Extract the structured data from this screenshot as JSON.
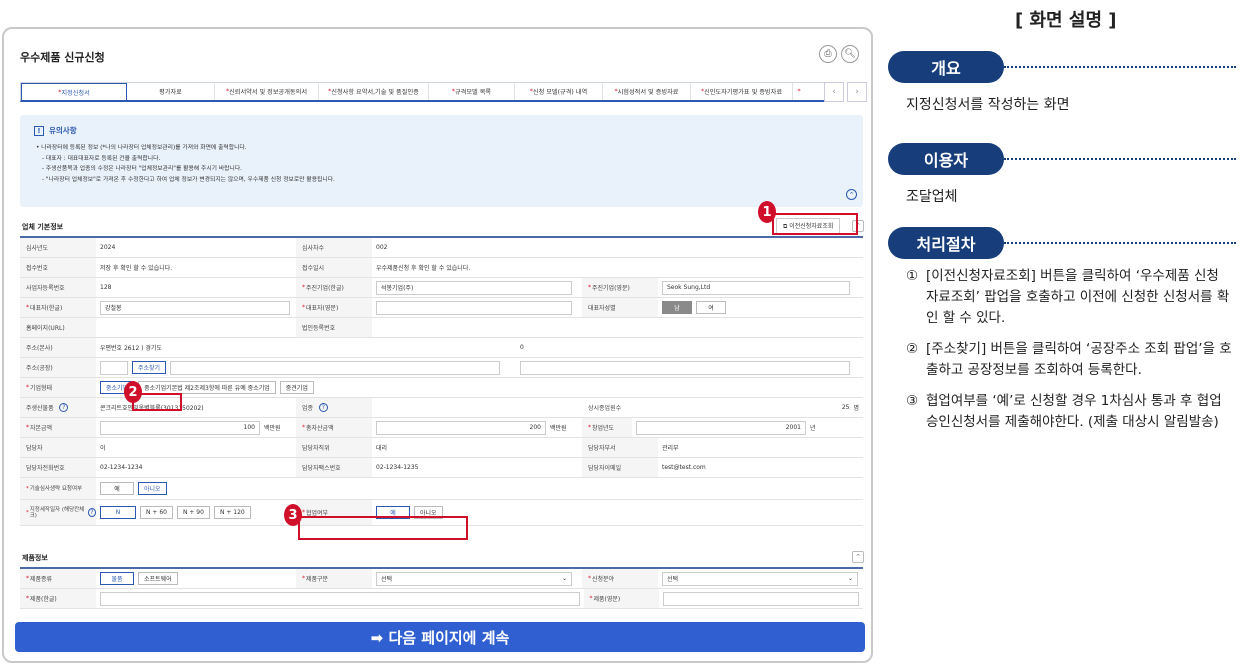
{
  "app": {
    "title": "우수제품 신규신청"
  },
  "tabs": [
    {
      "label": "지정신청서",
      "required": true,
      "active": true
    },
    {
      "label": "평가자료",
      "required": false
    },
    {
      "label": "신뢰서약서 및 정보공개동의서",
      "required": true
    },
    {
      "label": "신청사항 요약서,기술 및 품질인증",
      "required": true
    },
    {
      "label": "규격모델 목록",
      "required": true
    },
    {
      "label": "신청 모델(규격) 내역",
      "required": true
    },
    {
      "label": "시험성적서 및 증빙자료",
      "required": true
    },
    {
      "label": "신인도자기평가표 및 증빙자료",
      "required": true
    },
    {
      "label": "",
      "required": true
    }
  ],
  "notice": {
    "title": "유의사항",
    "lines": [
      "• 나라장터에 등록된 정보 (*나의 나라장터 업체정보관리)를 가져와 화면에 출력합니다.",
      "  - 대표자 : 대표대표자로 등록된 건을 출력합니다.",
      "  - 주생산품목과 업종의 수정은 나라장터 \"업체정보관리\"를 활용해 주시기 바랍니다.",
      "  - \"나라장터 업체정보\"로 가져온 후 수정한다고 하여 업체 정보가 변경되지는 않으며, 우수제품 신청 정보로만 활용됩니다."
    ]
  },
  "company_section": {
    "title": "업체 기본정보",
    "prev_button": "이전신청자료조회"
  },
  "company": {
    "year_label": "심사년도",
    "year": "2024",
    "round_label": "심사차수",
    "round": "002",
    "receipt_label": "접수번호",
    "receipt": "저장 후 확인 할 수 있습니다.",
    "receipt_date_label": "접수일시",
    "receipt_date": "우수제품신청 후 확인 할 수 있습니다.",
    "biz_no_label": "사업자등록번호",
    "biz_no": "128",
    "main_co_ko_label": "주진기업(한글)",
    "main_co_ko": "석봉기업(주)",
    "main_co_en_label": "주진기업(영문)",
    "main_co_en": "Seok Sung,Ltd",
    "ceo_ko_label": "대표자(한글)",
    "ceo_ko": "강철봉",
    "ceo_en_label": "대표자(영문)",
    "ceo_en": "",
    "ceo_gender_label": "대표자성별",
    "gender_m": "남",
    "gender_f": "여",
    "homepage_label": "홈페이지(URL)",
    "corp_no_label": "법인등록번호",
    "addr_hq_label": "주소(본사)",
    "addr_hq": "우편번호 2612 ) 경기도",
    "addr_hq_suffix": "0",
    "addr_factory_label": "주소(공장)",
    "addr_search_button": "주소찾기",
    "company_type_label": "기업형태",
    "type_small": "중소기업",
    "type_mid": "중소기업기본법 제2조제3항에 따른 유예 중소기업",
    "type_medium": "중견기업",
    "main_product_label": "주생산물품",
    "main_product": "콘크리트호안및옹벽블록(3013150202)",
    "industry_label": "업종",
    "employees_label": "상시종업원수",
    "employees": "25",
    "employees_unit": "명",
    "capital_label": "자본금액",
    "capital": "100",
    "capital_unit": "백만원",
    "total_assets_label": "총자산금액",
    "total_assets": "200",
    "total_assets_unit": "백만원",
    "founded_label": "창업년도",
    "founded": "2001",
    "founded_unit": "년",
    "manager_label": "담당자",
    "manager": "이",
    "manager_title_label": "담당자직위",
    "manager_title": "대리",
    "manager_dept_label": "담당자부서",
    "manager_dept": "관리부",
    "manager_phone_label": "담당자전화번호",
    "manager_phone": "02-1234-1234",
    "manager_fax_label": "담당자팩스번호",
    "manager_fax": "02-1234-1235",
    "manager_email_label": "담당자이메일",
    "manager_email": "test@test.com",
    "tech_review_label": "기술심사생략 요청여부",
    "yes": "예",
    "no": "아니오",
    "designation_label": "지정세작일자 (해당칸체크)",
    "d_n": "N",
    "d_60": "N + 60",
    "d_90": "N + 90",
    "d_120": "N + 120",
    "collab_label": "협업여부"
  },
  "product_section": {
    "title": "제품정보"
  },
  "product": {
    "type_label": "제품종류",
    "type_goods": "물품",
    "type_software": "소프트웨어",
    "category_label": "제품구분",
    "category_value": "선택",
    "field_label": "신청분야",
    "field_value": "선택",
    "name_ko_label": "제품(한글)",
    "name_en_label": "제품(영문)"
  },
  "next_button": "➡ 다음 페이지에 계속",
  "side": {
    "title": "[ 화면 설명 ]",
    "overview_pill": "개요",
    "overview_text": "지정신청서를 작성하는 화면",
    "user_pill": "이용자",
    "user_text": "조달업체",
    "process_pill": "처리절차",
    "steps": [
      {
        "n": "①",
        "text": "[이전신청자료조회] 버튼을 클릭하여 ‘우수제품 신청 자료조회’ 팝업을 호출하고 이전에 신청한 신청서를 확인 할 수 있다."
      },
      {
        "n": "②",
        "text": "[주소찾기] 버튼을 클릭하여 ‘공장주소 조회 팝업’을 호출하고 공장정보를 조회하여 등록한다."
      },
      {
        "n": "③",
        "text": "협업여부를 ‘예’로 신청할 경우 1차심사 통과 후 협업승인신청서를 제출해야한다. (제출 대상시 알림발송)"
      }
    ]
  },
  "callouts": [
    "1",
    "2",
    "3"
  ],
  "colors": {
    "primary": "#2c59b0",
    "accent_red": "#d0102b",
    "pill": "#173d7a",
    "next_button": "#2f5fd0"
  }
}
